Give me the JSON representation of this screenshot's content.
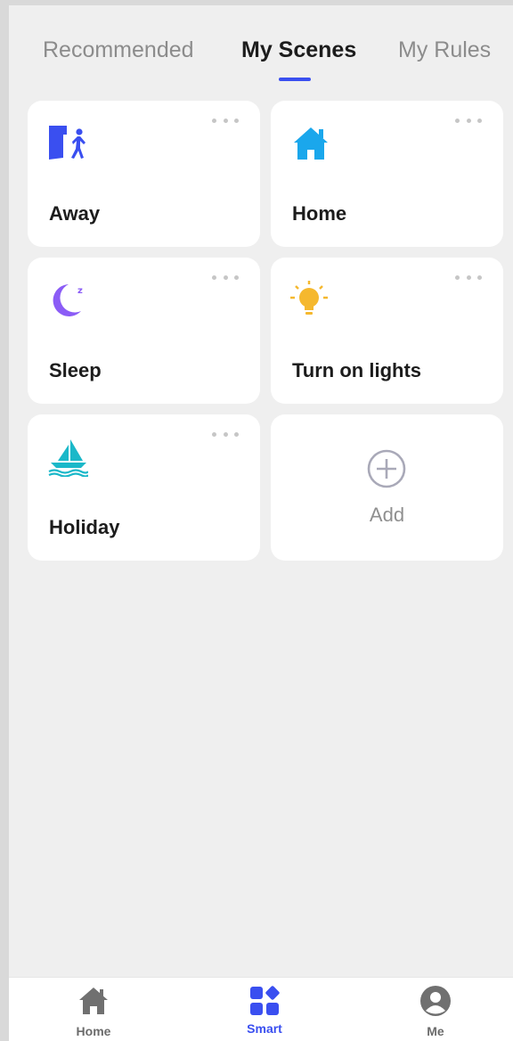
{
  "tabs": [
    {
      "label": "Recommended"
    },
    {
      "label": "My Scenes"
    },
    {
      "label": "My Rules"
    }
  ],
  "active_tab": "My Scenes",
  "scenes": [
    {
      "name": "Away",
      "icon": "exit-person-icon"
    },
    {
      "name": "Home",
      "icon": "house-icon"
    },
    {
      "name": "Sleep",
      "icon": "moon-sleep-icon"
    },
    {
      "name": "Turn on lights",
      "icon": "lightbulb-icon"
    },
    {
      "name": "Holiday",
      "icon": "sailboat-icon"
    }
  ],
  "add_card": {
    "label": "Add",
    "icon": "plus-circle-icon"
  },
  "bottom_nav": [
    {
      "label": "Home",
      "icon": "house-icon"
    },
    {
      "label": "Smart",
      "icon": "smart-grid-icon"
    },
    {
      "label": "Me",
      "icon": "user-avatar-icon"
    }
  ],
  "active_nav": "Smart",
  "colors": {
    "accent": "#3a4ff0",
    "background": "#efefef",
    "card": "#ffffff",
    "away_icon": "#3a4ff0",
    "home_icon": "#1aa7ec",
    "sleep_icon": "#8b5cf6",
    "lights_icon": "#f5b82e",
    "holiday_icon": "#1bb8c9"
  }
}
